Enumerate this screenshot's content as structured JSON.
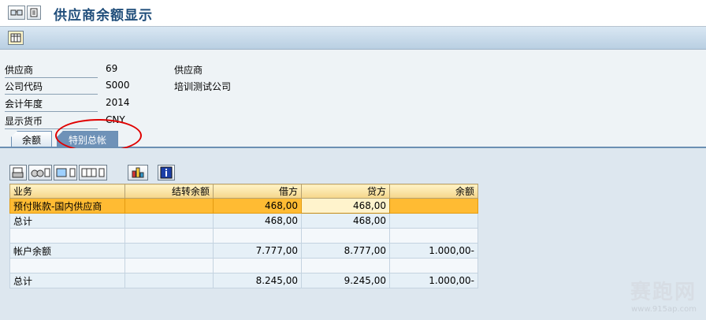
{
  "title": "供应商余额显示",
  "fields": [
    {
      "label": "供应商",
      "value": "69",
      "desc": "供应商"
    },
    {
      "label": "公司代码",
      "value": "S000",
      "desc": "培训测试公司"
    },
    {
      "label": "会计年度",
      "value": "2014",
      "desc": ""
    },
    {
      "label": "显示货币",
      "value": "CNY",
      "desc": ""
    }
  ],
  "tabs": [
    {
      "label": "余额"
    },
    {
      "label": "特别总帐"
    }
  ],
  "table": {
    "headers": [
      "业务",
      "结转余额",
      "借方",
      "贷方",
      "余额"
    ],
    "rows": [
      [
        "预付账款-国内供应商",
        "",
        "468,00",
        "468,00",
        ""
      ],
      [
        "总计",
        "",
        "468,00",
        "468,00",
        ""
      ],
      [
        "",
        "",
        "",
        "",
        ""
      ],
      [
        "帐户余额",
        "",
        "7.777,00",
        "8.777,00",
        "1.000,00-"
      ],
      [
        "",
        "",
        "",
        "",
        ""
      ],
      [
        "总计",
        "",
        "8.245,00",
        "9.245,00",
        "1.000,00-"
      ]
    ]
  },
  "watermark": {
    "main": "赛跑网",
    "sub": "www.915ap.com"
  },
  "colors": {
    "selected_row": "#ffbb33",
    "header_bg": "#f5d68a",
    "active_tab": "#6f92b8",
    "annotation": "#e00000"
  }
}
